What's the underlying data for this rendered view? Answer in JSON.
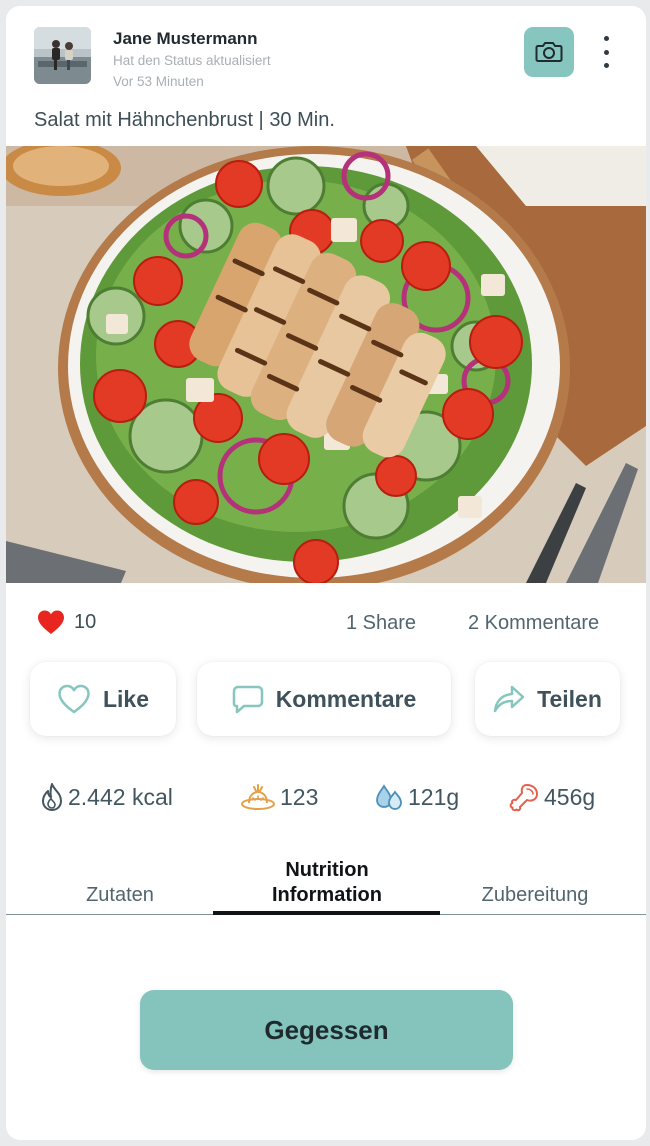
{
  "post": {
    "author": "Jane Mustermann",
    "status": "Hat den Status aktualisiert",
    "time": "Vor 53 Minuten",
    "title": "Salat mit Hähnchenbrust | 30 Min."
  },
  "stats": {
    "likes": "10",
    "shares": "1 Share",
    "comments": "2 Kommentare"
  },
  "actions": {
    "like": "Like",
    "comment": "Kommentare",
    "share": "Teilen"
  },
  "nutrition": {
    "kcal": "2.442 kcal",
    "carbs": "123",
    "fat": "121g",
    "protein": "456g"
  },
  "tabs": {
    "zutaten": "Zutaten",
    "nutrition_line1": "Nutrition",
    "nutrition_line2": "Information",
    "zubereitung": "Zubereitung"
  },
  "eaten_button": "Gegessen",
  "icons": {
    "camera": "camera-icon",
    "more": "more-vertical-icon",
    "heart": "heart-icon",
    "like": "heart-outline-icon",
    "comment": "speech-bubble-icon",
    "share": "share-arrow-icon",
    "kcal": "flame-icon",
    "carbs": "bread-icon",
    "fat": "droplets-icon",
    "protein": "drumstick-icon"
  },
  "colors": {
    "accent": "#86c6be",
    "heart": "#e8261f",
    "text": "#3d4e57"
  }
}
